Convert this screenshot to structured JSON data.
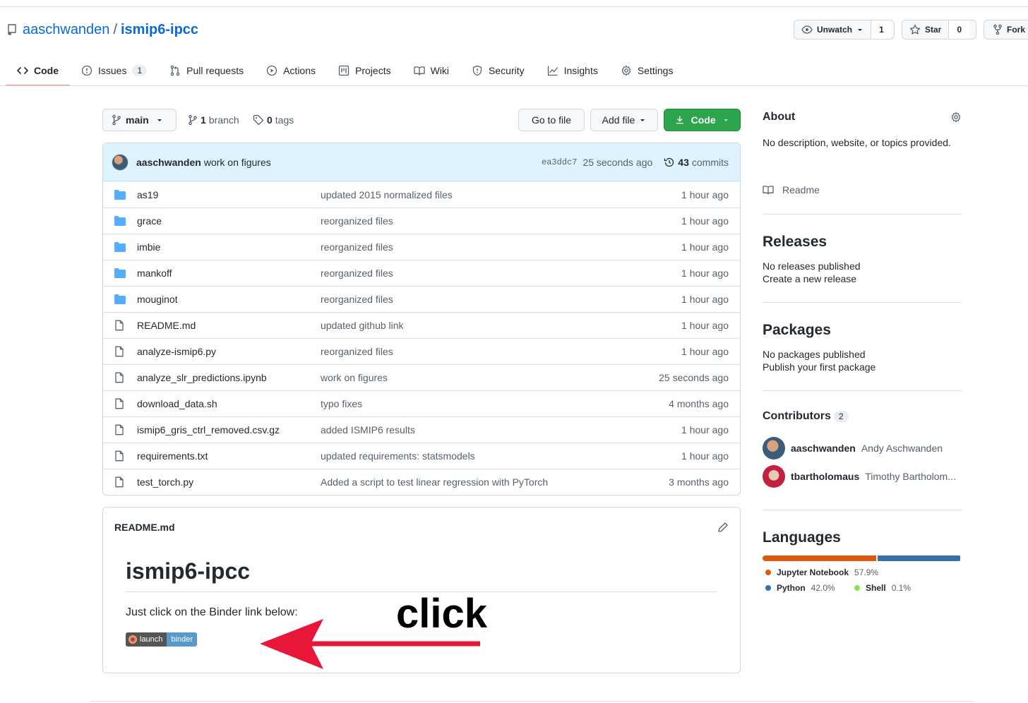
{
  "repo": {
    "owner": "aaschwanden",
    "separator": "/",
    "name": "ismip6-ipcc"
  },
  "header_buttons": {
    "watch": {
      "label": "Unwatch",
      "count": "1"
    },
    "star": {
      "label": "Star",
      "count": "0"
    },
    "fork": {
      "label": "Fork"
    }
  },
  "tabs": [
    {
      "label": "Code",
      "icon": "code-icon"
    },
    {
      "label": "Issues",
      "badge": "1",
      "icon": "issue-icon"
    },
    {
      "label": "Pull requests",
      "icon": "pull-request-icon"
    },
    {
      "label": "Actions",
      "icon": "play-icon"
    },
    {
      "label": "Projects",
      "icon": "project-icon"
    },
    {
      "label": "Wiki",
      "icon": "book-icon"
    },
    {
      "label": "Security",
      "icon": "shield-icon"
    },
    {
      "label": "Insights",
      "icon": "graph-icon"
    },
    {
      "label": "Settings",
      "icon": "gear-icon"
    }
  ],
  "toolbar": {
    "branch": "main",
    "branches_count": "1",
    "branches_label": "branch",
    "tags_count": "0",
    "tags_label": "tags",
    "go_to_file": "Go to file",
    "add_file": "Add file",
    "code": "Code"
  },
  "latest_commit": {
    "author": "aaschwanden",
    "message": "work on figures",
    "sha": "ea3ddc7",
    "time": "25 seconds ago",
    "commits_count": "43",
    "commits_label": "commits"
  },
  "files": [
    {
      "type": "dir",
      "name": "as19",
      "message": "updated 2015 normalized files",
      "age": "1 hour ago"
    },
    {
      "type": "dir",
      "name": "grace",
      "message": "reorganized files",
      "age": "1 hour ago"
    },
    {
      "type": "dir",
      "name": "imbie",
      "message": "reorganized files",
      "age": "1 hour ago"
    },
    {
      "type": "dir",
      "name": "mankoff",
      "message": "reorganized files",
      "age": "1 hour ago"
    },
    {
      "type": "dir",
      "name": "mouginot",
      "message": "reorganized files",
      "age": "1 hour ago"
    },
    {
      "type": "file",
      "name": "README.md",
      "message": "updated github link",
      "age": "1 hour ago"
    },
    {
      "type": "file",
      "name": "analyze-ismip6.py",
      "message": "reorganized files",
      "age": "1 hour ago"
    },
    {
      "type": "file",
      "name": "analyze_slr_predictions.ipynb",
      "message": "work on figures",
      "age": "25 seconds ago"
    },
    {
      "type": "file",
      "name": "download_data.sh",
      "message": "typo fixes",
      "age": "4 months ago"
    },
    {
      "type": "file",
      "name": "ismip6_gris_ctrl_removed.csv.gz",
      "message": "added ISMIP6 results",
      "age": "1 hour ago"
    },
    {
      "type": "file",
      "name": "requirements.txt",
      "message": "updated requirements: statsmodels",
      "age": "1 hour ago"
    },
    {
      "type": "file",
      "name": "test_torch.py",
      "message": "Added a script to test linear regression with PyTorch",
      "age": "3 months ago"
    }
  ],
  "readme": {
    "filename": "README.md",
    "title": "ismip6-ipcc",
    "text": "Just click on the Binder link below:",
    "badge_left": "launch",
    "badge_right": "binder"
  },
  "annotation": {
    "label": "click",
    "color": "#e8173a"
  },
  "about": {
    "title": "About",
    "description": "No description, website, or topics provided.",
    "readme_link": "Readme"
  },
  "releases": {
    "title": "Releases",
    "empty": "No releases published",
    "action": "Create a new release"
  },
  "packages": {
    "title": "Packages",
    "empty": "No packages published",
    "action": "Publish your first package"
  },
  "contributors": {
    "title": "Contributors",
    "count": "2",
    "people": [
      {
        "login": "aaschwanden",
        "name": "Andy Aschwanden"
      },
      {
        "login": "tbartholomaus",
        "name": "Timothy Bartholom..."
      }
    ]
  },
  "languages": {
    "title": "Languages",
    "items": [
      {
        "name": "Jupyter Notebook",
        "percent": "57.9%",
        "value": 57.9,
        "color": "#DA5B0B"
      },
      {
        "name": "Python",
        "percent": "42.0%",
        "value": 42.0,
        "color": "#3572A5"
      },
      {
        "name": "Shell",
        "percent": "0.1%",
        "value": 0.1,
        "color": "#89e051"
      }
    ]
  },
  "colors": {
    "link": "#0969da",
    "green_button": "#2da44e",
    "commit_bar": "#ddf4ff"
  }
}
